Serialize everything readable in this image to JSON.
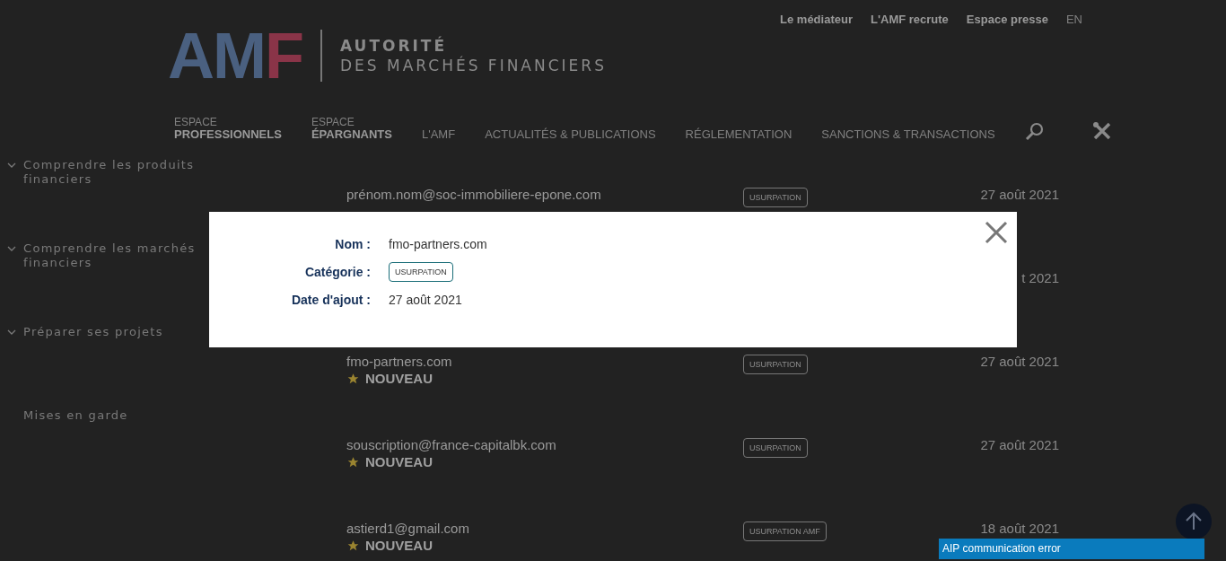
{
  "top_links": [
    "Le médiateur",
    "L'AMF recrute",
    "Espace presse",
    "EN"
  ],
  "logo": {
    "letters": [
      {
        "text": "A",
        "color": "#4a6080"
      },
      {
        "text": "M",
        "color": "#4a6080"
      },
      {
        "text": "F",
        "color": "#8a3448"
      }
    ],
    "line_1": "AUTORITÉ",
    "line_2": "DES MARCHÉS FINANCIERS"
  },
  "nav": [
    {
      "kind": "space",
      "small": "ESPACE",
      "label": "PROFESSIONNELS"
    },
    {
      "kind": "space",
      "small": "ESPACE",
      "label": "ÉPARGNANTS"
    },
    {
      "kind": "link",
      "label": "L'AMF"
    },
    {
      "kind": "link",
      "label": "ACTUALITÉS & PUBLICATIONS"
    },
    {
      "kind": "link",
      "label": "RÉGLEMENTATION"
    },
    {
      "kind": "link",
      "label": "SANCTIONS & TRANSACTIONS"
    }
  ],
  "sidebar": [
    {
      "label": "Comprendre les produits financiers",
      "expandable": true
    },
    {
      "label": "Comprendre les marchés financiers",
      "expandable": true
    },
    {
      "label": "Préparer ses projets",
      "expandable": true
    },
    {
      "label": "Mises en garde",
      "expandable": false
    }
  ],
  "rows": [
    {
      "name": "prénom.nom@soc-immobiliere-epone.com",
      "category": "USURPATION",
      "date": "27 août 2021"
    },
    {
      "date": "t 2021"
    },
    {
      "name": "fmo-partners.com",
      "new": "NOUVEAU",
      "category": "USURPATION",
      "date": "27 août 2021"
    },
    {
      "name": "souscription@france-capitalbk.com",
      "new": "NOUVEAU",
      "category": "USURPATION",
      "date": "27 août 2021"
    },
    {
      "name": "astierd1@gmail.com",
      "new": "NOUVEAU",
      "category": "USURPATION AMF",
      "date": "18 août 2021"
    }
  ],
  "modal": {
    "fields": [
      {
        "kind": "text",
        "label": "Nom :",
        "value": "fmo-partners.com"
      },
      {
        "kind": "tag",
        "label": "Catégorie :",
        "value": "USURPATION"
      },
      {
        "kind": "text",
        "label": "Date d'ajout :",
        "value": "27 août 2021"
      }
    ]
  },
  "error_banner": "AIP communication error"
}
